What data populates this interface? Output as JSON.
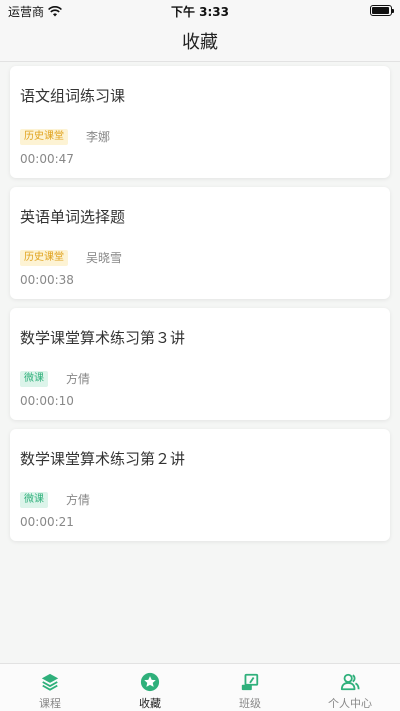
{
  "status_bar": {
    "carrier": "运营商",
    "time": "下午 3:33"
  },
  "nav": {
    "title": "收藏"
  },
  "favorites": [
    {
      "title": "语文组词练习课",
      "tag": "历史课堂",
      "tag_type": "history",
      "teacher": "李娜",
      "duration": "00:00:47"
    },
    {
      "title": "英语单词选择题",
      "tag": "历史课堂",
      "tag_type": "history",
      "teacher": "吴晓雪",
      "duration": "00:00:38"
    },
    {
      "title": "数学课堂算术练习第３讲",
      "tag": "微课",
      "tag_type": "micro",
      "teacher": "方倩",
      "duration": "00:00:10"
    },
    {
      "title": "数学课堂算术练习第２讲",
      "tag": "微课",
      "tag_type": "micro",
      "teacher": "方倩",
      "duration": "00:00:21"
    }
  ],
  "tabs": [
    {
      "label": "课程",
      "icon": "layers-icon",
      "active": false
    },
    {
      "label": "收藏",
      "icon": "star-icon",
      "active": true
    },
    {
      "label": "班级",
      "icon": "classroom-icon",
      "active": false
    },
    {
      "label": "个人中心",
      "icon": "user-group-icon",
      "active": false
    }
  ],
  "colors": {
    "accent": "#2fb07b",
    "history_tag_bg": "#fdf3d4",
    "history_tag_text": "#e0a21c",
    "micro_tag_bg": "#dcf4ea"
  }
}
